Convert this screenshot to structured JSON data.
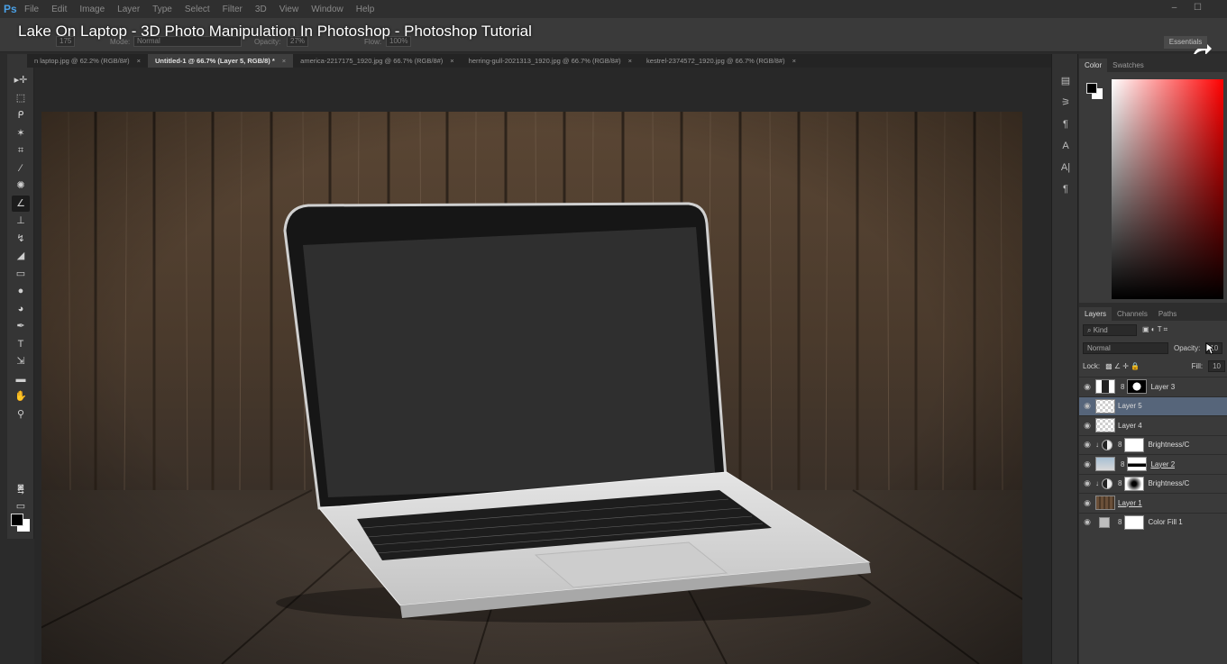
{
  "app": {
    "logo": "Ps",
    "menu": [
      "File",
      "Edit",
      "Image",
      "Layer",
      "Type",
      "Select",
      "Filter",
      "3D",
      "View",
      "Window",
      "Help"
    ],
    "window_controls": "– ☐"
  },
  "video": {
    "title": "Lake On Laptop - 3D Photo Manipulation In Photoshop - Photoshop Tutorial"
  },
  "options": {
    "brush_size": "175",
    "mode_label": "Mode:",
    "mode_value": "Normal",
    "opacity_label": "Opacity:",
    "opacity_value": "27%",
    "flow_label": "Flow:",
    "flow_value": "100%",
    "workspace": "Essentials"
  },
  "tabs": [
    {
      "label": "n laptop.jpg @ 62.2% (RGB/8#)",
      "active": false
    },
    {
      "label": "Untitled-1 @ 66.7% (Layer 5, RGB/8) *",
      "active": true
    },
    {
      "label": "america-2217175_1920.jpg @ 66.7% (RGB/8#)",
      "active": false
    },
    {
      "label": "herring-gull-2021313_1920.jpg @ 66.7% (RGB/8#)",
      "active": false
    },
    {
      "label": "kestrel-2374572_1920.jpg @ 66.7% (RGB/8#)",
      "active": false
    }
  ],
  "tab_close": "×",
  "tools": [
    {
      "name": "move-tool-icon",
      "glyph": "▸✛"
    },
    {
      "name": "marquee-tool-icon",
      "glyph": "⬚"
    },
    {
      "name": "lasso-tool-icon",
      "glyph": "ᑭ"
    },
    {
      "name": "magic-wand-tool-icon",
      "glyph": "✶"
    },
    {
      "name": "crop-tool-icon",
      "glyph": "⌗"
    },
    {
      "name": "eyedropper-tool-icon",
      "glyph": "∕"
    },
    {
      "name": "healing-brush-tool-icon",
      "glyph": "✺"
    },
    {
      "name": "brush-tool-icon",
      "glyph": "∠"
    },
    {
      "name": "clone-stamp-tool-icon",
      "glyph": "⊥"
    },
    {
      "name": "history-brush-tool-icon",
      "glyph": "↯"
    },
    {
      "name": "eraser-tool-icon",
      "glyph": "◢"
    },
    {
      "name": "gradient-tool-icon",
      "glyph": "▭"
    },
    {
      "name": "blur-tool-icon",
      "glyph": "●"
    },
    {
      "name": "dodge-tool-icon",
      "glyph": "◕"
    },
    {
      "name": "pen-tool-icon",
      "glyph": "✒"
    },
    {
      "name": "type-tool-icon",
      "glyph": "T"
    },
    {
      "name": "path-selection-tool-icon",
      "glyph": "⇲"
    },
    {
      "name": "shape-tool-icon",
      "glyph": "▬"
    },
    {
      "name": "hand-tool-icon",
      "glyph": "✋"
    },
    {
      "name": "zoom-tool-icon",
      "glyph": "⚲"
    }
  ],
  "side_icons": [
    "▤",
    "⚞",
    "¶",
    "A",
    "A|",
    "¶"
  ],
  "color_panel": {
    "tabs": [
      "Color",
      "Swatches"
    ]
  },
  "layers_panel": {
    "tabs": [
      "Layers",
      "Channels",
      "Paths"
    ],
    "kind_label": "Kind",
    "filter_icons": "▣ ◐ T ⌗",
    "blend_mode": "Normal",
    "opacity_label": "Opacity:",
    "opacity_value": "10",
    "lock_label": "Lock:",
    "lock_icons": "▩ ∠ ✛ 🔒",
    "fill_label": "Fill:",
    "fill_value": "10",
    "layers": [
      {
        "name": "Layer 3",
        "thumb": "mixed",
        "mask": "black-white",
        "link": "8",
        "selected": false,
        "underline": false,
        "fx": ""
      },
      {
        "name": "Layer 5",
        "thumb": "checker",
        "mask": "",
        "link": "",
        "selected": true,
        "underline": false,
        "fx": ""
      },
      {
        "name": "Layer 4",
        "thumb": "checker",
        "mask": "",
        "link": "",
        "selected": false,
        "underline": false,
        "fx": ""
      },
      {
        "name": "Brightness/C",
        "thumb": "adjust",
        "mask": "white",
        "link": "8",
        "selected": false,
        "underline": false,
        "fx": "↓"
      },
      {
        "name": "Layer 2",
        "thumb": "sky",
        "mask": "black-bar",
        "link": "8",
        "selected": false,
        "underline": true,
        "fx": ""
      },
      {
        "name": "Brightness/C",
        "thumb": "adjust",
        "mask": "radial",
        "link": "8",
        "selected": false,
        "underline": false,
        "fx": "↓"
      },
      {
        "name": "Layer 1",
        "thumb": "wood",
        "mask": "",
        "link": "",
        "selected": false,
        "underline": true,
        "fx": ""
      },
      {
        "name": "Color Fill 1",
        "thumb": "gray",
        "mask": "white",
        "link": "8",
        "selected": false,
        "underline": false,
        "fx": ""
      }
    ]
  },
  "eye_glyph": "◉"
}
